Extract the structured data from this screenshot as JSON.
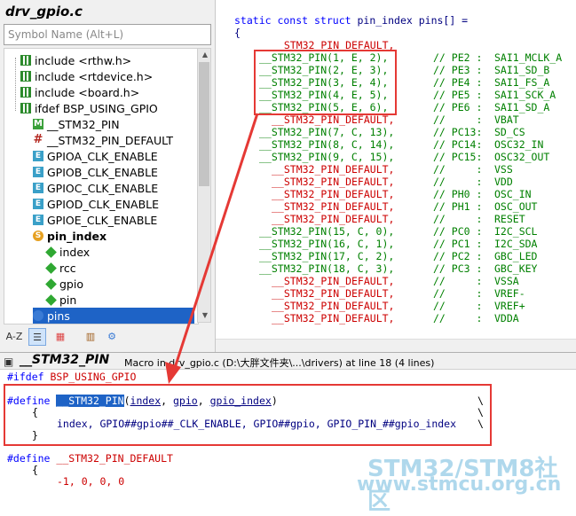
{
  "left_panel": {
    "title": "drv_gpio.c",
    "search_placeholder": "Symbol Name (Alt+L)",
    "tree": [
      {
        "label": "include <rthw.h>",
        "icon": "include-icon",
        "bold": false
      },
      {
        "label": "include <rtdevice.h>",
        "icon": "include-icon",
        "bold": false
      },
      {
        "label": "include <board.h>",
        "icon": "include-icon",
        "bold": false
      },
      {
        "label": "ifdef BSP_USING_GPIO",
        "icon": "ifdef-icon",
        "bold": false
      },
      {
        "label": "__STM32_PIN",
        "icon": "macro-icon",
        "bold": false
      },
      {
        "label": "__STM32_PIN_DEFAULT",
        "icon": "define-icon",
        "bold": false
      },
      {
        "label": "GPIOA_CLK_ENABLE",
        "icon": "enum-icon",
        "bold": false
      },
      {
        "label": "GPIOB_CLK_ENABLE",
        "icon": "enum-icon",
        "bold": false
      },
      {
        "label": "GPIOC_CLK_ENABLE",
        "icon": "enum-icon",
        "bold": false
      },
      {
        "label": "GPIOD_CLK_ENABLE",
        "icon": "enum-icon",
        "bold": false
      },
      {
        "label": "GPIOE_CLK_ENABLE",
        "icon": "enum-icon",
        "bold": false
      },
      {
        "label": "pin_index",
        "icon": "struct-icon",
        "bold": true
      },
      {
        "label": "index",
        "icon": "field-icon",
        "bold": false
      },
      {
        "label": "rcc",
        "icon": "field-icon",
        "bold": false
      },
      {
        "label": "gpio",
        "icon": "field-icon",
        "bold": false
      },
      {
        "label": "pin",
        "icon": "field-icon",
        "bold": false
      },
      {
        "label": "pins",
        "icon": "variable-icon",
        "bold": false,
        "selected": true
      }
    ],
    "toolbar": [
      "A-Z",
      "list-icon",
      "grid-icon",
      "book-icon",
      "gear-icon"
    ]
  },
  "code": {
    "header_kw": "static const struct",
    "header_rest": " pin_index pins[] =",
    "brace": "{",
    "rows": [
      {
        "macro": "__STM32_PIN_DEFAULT,",
        "green": false,
        "comment": "",
        "alt": ""
      },
      {
        "macro": "__STM32_PIN(1, E, 2),",
        "green": true,
        "comment": "// PE2 :",
        "alt": "SAI1_MCLK_A"
      },
      {
        "macro": "__STM32_PIN(2, E, 3),",
        "green": true,
        "comment": "// PE3 :",
        "alt": "SAI1_SD_B"
      },
      {
        "macro": "__STM32_PIN(3, E, 4),",
        "green": true,
        "comment": "// PE4 :",
        "alt": "SAI1_FS_A"
      },
      {
        "macro": "__STM32_PIN(4, E, 5),",
        "green": true,
        "comment": "// PE5 :",
        "alt": "SAI1_SCK_A"
      },
      {
        "macro": "__STM32_PIN(5, E, 6),",
        "green": true,
        "comment": "// PE6 :",
        "alt": "SAI1_SD_A"
      },
      {
        "macro": "__STM32_PIN_DEFAULT,",
        "green": false,
        "comment": "//     :",
        "alt": "VBAT"
      },
      {
        "macro": "__STM32_PIN(7, C, 13),",
        "green": true,
        "comment": "// PC13:",
        "alt": "SD_CS"
      },
      {
        "macro": "__STM32_PIN(8, C, 14),",
        "green": true,
        "comment": "// PC14:",
        "alt": "OSC32_IN"
      },
      {
        "macro": "__STM32_PIN(9, C, 15),",
        "green": true,
        "comment": "// PC15:",
        "alt": "OSC32_OUT"
      },
      {
        "macro": "__STM32_PIN_DEFAULT,",
        "green": false,
        "comment": "//     :",
        "alt": "VSS"
      },
      {
        "macro": "__STM32_PIN_DEFAULT,",
        "green": false,
        "comment": "//     :",
        "alt": "VDD"
      },
      {
        "macro": "__STM32_PIN_DEFAULT,",
        "green": false,
        "comment": "// PH0 :",
        "alt": "OSC_IN"
      },
      {
        "macro": "__STM32_PIN_DEFAULT,",
        "green": false,
        "comment": "// PH1 :",
        "alt": "OSC_OUT"
      },
      {
        "macro": "__STM32_PIN_DEFAULT,",
        "green": false,
        "comment": "//     :",
        "alt": "RESET"
      },
      {
        "macro": "__STM32_PIN(15, C, 0),",
        "green": true,
        "comment": "// PC0 :",
        "alt": "I2C_SCL"
      },
      {
        "macro": "__STM32_PIN(16, C, 1),",
        "green": true,
        "comment": "// PC1 :",
        "alt": "I2C_SDA"
      },
      {
        "macro": "__STM32_PIN(17, C, 2),",
        "green": true,
        "comment": "// PC2 :",
        "alt": "GBC_LED"
      },
      {
        "macro": "__STM32_PIN(18, C, 3),",
        "green": true,
        "comment": "// PC3 :",
        "alt": "GBC_KEY"
      },
      {
        "macro": "__STM32_PIN_DEFAULT,",
        "green": false,
        "comment": "//     :",
        "alt": "VSSA"
      },
      {
        "macro": "__STM32_PIN_DEFAULT,",
        "green": false,
        "comment": "//     :",
        "alt": "VREF-"
      },
      {
        "macro": "__STM32_PIN_DEFAULT,",
        "green": false,
        "comment": "//     :",
        "alt": "VREF+"
      },
      {
        "macro": "__STM32_PIN_DEFAULT,",
        "green": false,
        "comment": "//     :",
        "alt": "VDDA"
      }
    ]
  },
  "info": {
    "symbol": "__STM32_PIN",
    "description": "Macro in drv_gpio.c (D:\\大胖文件夹\\...\\drivers) at line 18 (4 lines)",
    "line_ifdef_kw": "#ifdef",
    "line_ifdef_name": " BSP_USING_GPIO",
    "define_kw": "#define",
    "define_name": "__STM32_PIN",
    "define_params": [
      "index",
      "gpio",
      "gpio_index"
    ],
    "body_open": "{",
    "body_content": "index, GPIO##gpio##_CLK_ENABLE, GPIO##gpio, GPIO_PIN_##gpio_index",
    "body_close": "}",
    "continuation": "\\",
    "define2_kw": "#define",
    "define2_name": "__STM32_PIN_DEFAULT",
    "define2_open": "{",
    "define2_values": "-1, 0, 0, 0"
  },
  "watermark": {
    "line1": "STM32/STM8社区",
    "line2": "www.stmcu.org.cn"
  },
  "colors": {
    "highlight": "#e53935",
    "selection": "#1e63c6"
  }
}
